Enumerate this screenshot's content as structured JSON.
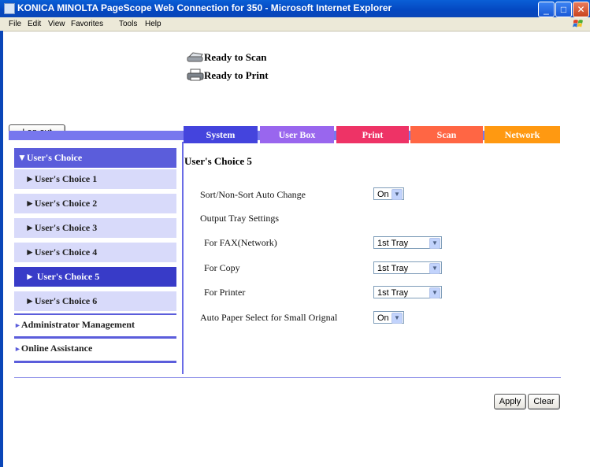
{
  "window": {
    "title": "KONICA MINOLTA PageScope Web Connection for 350 - Microsoft Internet Explorer",
    "minimize": "_",
    "maximize": "□",
    "close": "✕"
  },
  "menu": {
    "file": "File",
    "edit": "Edit",
    "view": "View",
    "favorites": "Favorites",
    "tools": "Tools",
    "help": "Help"
  },
  "status": {
    "scan": "Ready to Scan",
    "print": "Ready to Print"
  },
  "logout_label": "Log-out",
  "tabs": [
    {
      "label": "System",
      "color": "#4444dd"
    },
    {
      "label": "User Box",
      "color": "#9966ee"
    },
    {
      "label": "Print",
      "color": "#ee3366"
    },
    {
      "label": "Scan",
      "color": "#ff6644"
    },
    {
      "label": "Network",
      "color": "#ff9911"
    }
  ],
  "nav": {
    "section": "▼User's Choice",
    "items": [
      "►User's Choice 1",
      "►User's Choice 2",
      "►User's Choice 3",
      "►User's Choice 4",
      "► User's Choice 5",
      "►User's Choice 6"
    ],
    "admin": "Administrator Management",
    "online": "Online Assistance",
    "arrow": "►"
  },
  "main": {
    "heading": "User's Choice 5",
    "sort_label": "Sort/Non-Sort Auto Change",
    "sort_value": "On",
    "output_tray_label": "Output Tray Settings",
    "fax_label": "For FAX(Network)",
    "fax_value": "1st Tray",
    "copy_label": "For Copy",
    "copy_value": "1st Tray",
    "printer_label": "For Printer",
    "printer_value": "1st Tray",
    "aps_label": "Auto Paper Select for Small Orignal",
    "aps_value": "On"
  },
  "buttons": {
    "apply": "Apply",
    "clear": "Clear"
  }
}
